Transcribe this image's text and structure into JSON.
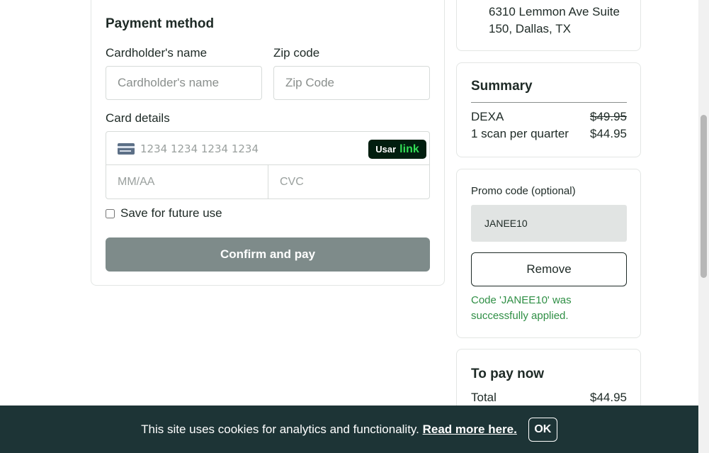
{
  "payment": {
    "title": "Payment method",
    "cardholder_label": "Cardholder's name",
    "cardholder_placeholder": "Cardholder's name",
    "zip_label": "Zip code",
    "zip_placeholder": "Zip Code",
    "card_details_label": "Card details",
    "card_number_placeholder": "1234 1234 1234 1234",
    "link_badge": {
      "prefix": "Usar",
      "brand": "link"
    },
    "expiry_placeholder": "MM/AA",
    "cvc_placeholder": "CVC",
    "save_label": "Save for future use",
    "save_checked": false,
    "confirm_label": "Confirm and pay",
    "card_icon": "credit-card-icon"
  },
  "address": {
    "line1": "6310 Lemmon Ave Suite",
    "line2": "150, Dallas, TX"
  },
  "summary": {
    "title": "Summary",
    "rows": [
      {
        "label": "DEXA",
        "value": "$49.95",
        "strikethrough": true
      },
      {
        "label": "1 scan per quarter",
        "value": "$44.95",
        "strikethrough": false
      }
    ]
  },
  "promo": {
    "label": "Promo code (optional)",
    "value": "JANEE10",
    "remove_label": "Remove",
    "success_message": "Code 'JANEE10' was successfully applied."
  },
  "to_pay": {
    "title": "To pay now",
    "total_label": "Total",
    "total_value": "$44.95"
  },
  "cookie_banner": {
    "text": "This site uses cookies for analytics and functionality.",
    "link_text": "Read more here.",
    "ok_label": "OK"
  },
  "colors": {
    "confirm_button": "#7e8b8a",
    "cookie_banner_bg": "#1d3436",
    "success_text": "#2f8f45",
    "link_badge_bg": "#011e0f",
    "link_badge_accent": "#33dd55"
  }
}
